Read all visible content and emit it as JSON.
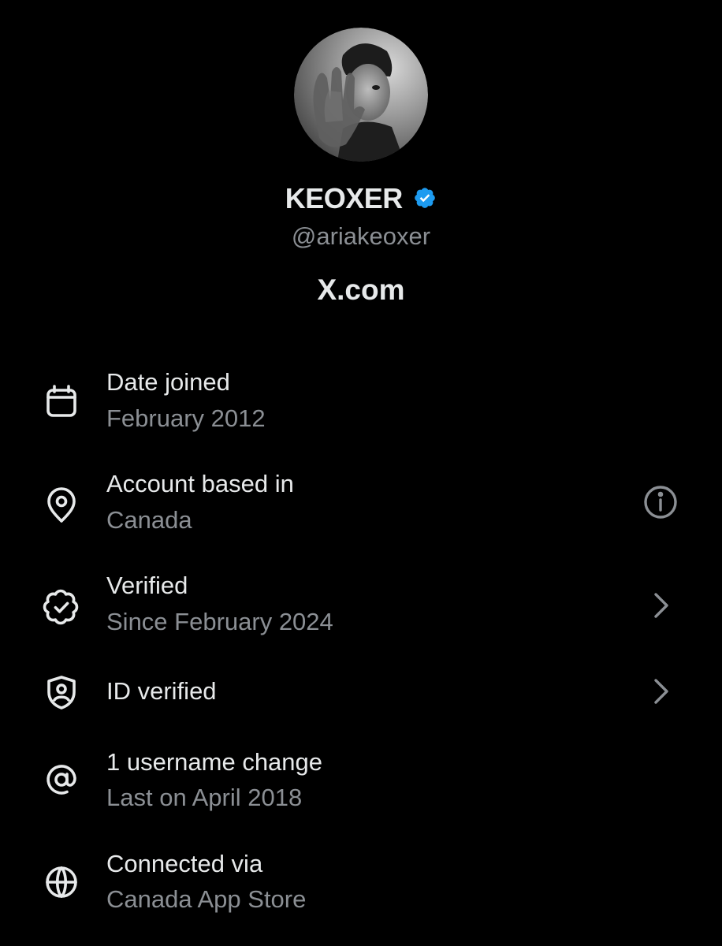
{
  "profile": {
    "display_name": "KEOXER",
    "handle": "@ariakeoxer",
    "site": "X.com",
    "verified": true
  },
  "about": [
    {
      "title": "Date joined",
      "subtitle": "February 2012",
      "icon": "calendar-icon"
    },
    {
      "title": "Account based in",
      "subtitle": "Canada",
      "icon": "location-pin-icon",
      "action": "info-icon"
    },
    {
      "title": "Verified",
      "subtitle": "Since February 2024",
      "icon": "verified-badge-icon",
      "action": "chevron-right-icon"
    },
    {
      "title": "ID verified",
      "icon": "shield-person-icon",
      "action": "chevron-right-icon"
    },
    {
      "title": "1 username change",
      "subtitle": "Last on April 2018",
      "icon": "at-sign-icon"
    },
    {
      "title": "Connected via",
      "subtitle": "Canada App Store",
      "icon": "globe-icon"
    }
  ],
  "colors": {
    "background": "#000000",
    "primary_text": "#e7e9ea",
    "secondary_text": "#8b8f94",
    "verified_blue": "#1d9bf0"
  }
}
